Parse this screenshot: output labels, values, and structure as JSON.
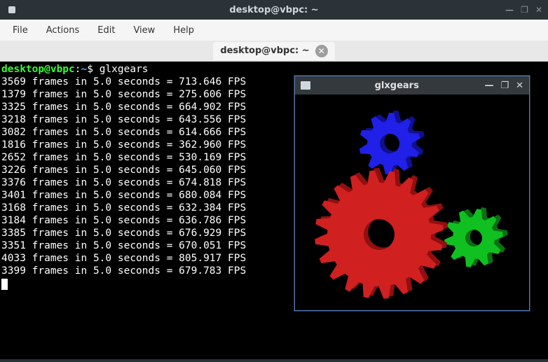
{
  "window": {
    "title": "desktop@vbpc: ~",
    "controls": {
      "min": "—",
      "max": "❐",
      "close": "✕"
    }
  },
  "menubar": {
    "items": [
      "File",
      "Actions",
      "Edit",
      "View",
      "Help"
    ]
  },
  "tab": {
    "label": "desktop@vbpc: ~",
    "close": "✕"
  },
  "prompt": {
    "user_host": "desktop@vbpc",
    "path": "~",
    "command": "glxgears"
  },
  "output_lines": [
    {
      "frames": 3569,
      "seconds": "5.0",
      "fps": "713.646"
    },
    {
      "frames": 1379,
      "seconds": "5.0",
      "fps": "275.606"
    },
    {
      "frames": 3325,
      "seconds": "5.0",
      "fps": "664.902"
    },
    {
      "frames": 3218,
      "seconds": "5.0",
      "fps": "643.556"
    },
    {
      "frames": 3082,
      "seconds": "5.0",
      "fps": "614.666"
    },
    {
      "frames": 1816,
      "seconds": "5.0",
      "fps": "362.960"
    },
    {
      "frames": 2652,
      "seconds": "5.0",
      "fps": "530.169"
    },
    {
      "frames": 3226,
      "seconds": "5.0",
      "fps": "645.060"
    },
    {
      "frames": 3376,
      "seconds": "5.0",
      "fps": "674.818"
    },
    {
      "frames": 3401,
      "seconds": "5.0",
      "fps": "680.084"
    },
    {
      "frames": 3168,
      "seconds": "5.0",
      "fps": "632.384"
    },
    {
      "frames": 3184,
      "seconds": "5.0",
      "fps": "636.786"
    },
    {
      "frames": 3385,
      "seconds": "5.0",
      "fps": "676.929"
    },
    {
      "frames": 3351,
      "seconds": "5.0",
      "fps": "670.051"
    },
    {
      "frames": 4033,
      "seconds": "5.0",
      "fps": "805.917"
    },
    {
      "frames": 3399,
      "seconds": "5.0",
      "fps": "679.783"
    }
  ],
  "gears_window": {
    "title": "glxgears",
    "controls": {
      "min": "—",
      "max": "❐",
      "close": "✕"
    }
  },
  "colors": {
    "gear_red": "#d02020",
    "gear_green": "#10c020",
    "gear_blue": "#2020e8"
  }
}
